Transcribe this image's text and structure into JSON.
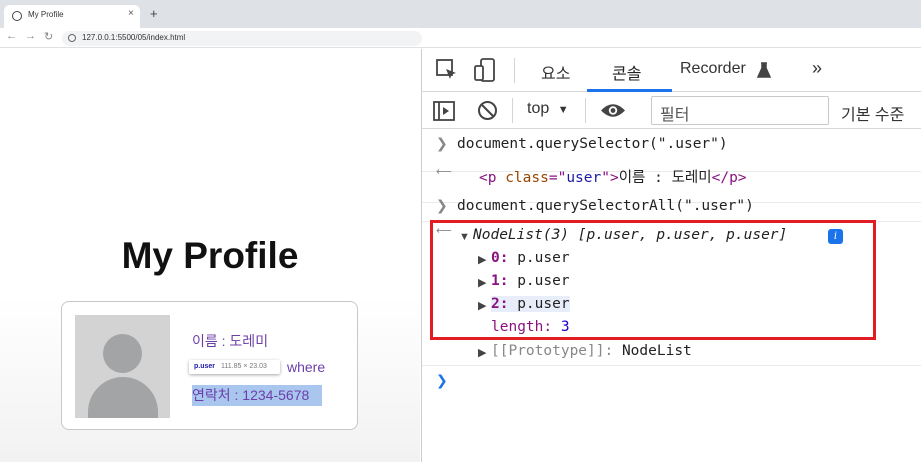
{
  "browser": {
    "tab_title": "My Profile",
    "tab_close": "×",
    "new_tab": "+",
    "url": "127.0.0.1:5500/05/index.html"
  },
  "page": {
    "title": "My Profile",
    "name_line": "이름 : 도레미",
    "address_line_visible": "where",
    "contact_line": "연락처 : 1234-5678",
    "tooltip_selector": "p.user",
    "tooltip_size": "111.85 × 23.03"
  },
  "devtools": {
    "tabs": [
      {
        "label": "요소"
      },
      {
        "label": "콘솔"
      },
      {
        "label": "Recorder"
      },
      {
        "label": "»"
      }
    ],
    "context": "top",
    "filter_placeholder": "필터",
    "levels": "기본 수준",
    "console": {
      "cmd1": "document.querySelector(\".user\")",
      "out1_open": "<p ",
      "out1_attr": "class",
      "out1_eq": "=\"",
      "out1_val": "user",
      "out1_close": "\">",
      "out1_text": "이름 : 도레미",
      "out1_end": "</p>",
      "cmd2": "document.querySelectorAll(\".user\")",
      "nodelist_head": "NodeList(3) [p.user, p.user, p.user]",
      "items": [
        {
          "key": "0:",
          "value": "p.user"
        },
        {
          "key": "1:",
          "value": "p.user"
        },
        {
          "key": "2:",
          "value": "p.user"
        }
      ],
      "length_key": "length:",
      "length_value": "3",
      "prototype_key": "[[Prototype]]:",
      "prototype_value": "NodeList"
    }
  },
  "colors": {
    "accent": "#1a73e8",
    "highlight_box": "#e31b23",
    "info_text": "#6c3fa8"
  }
}
